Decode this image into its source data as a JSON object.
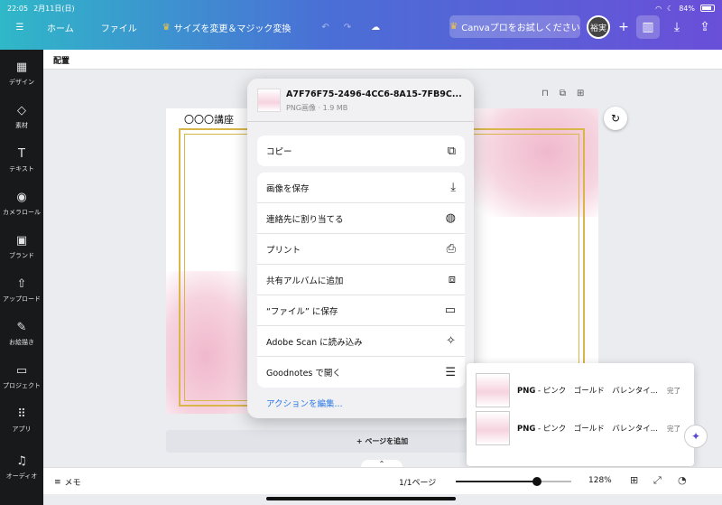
{
  "status_bar": {
    "time": "22:05",
    "date": "2月11日(日)",
    "battery": "84%"
  },
  "topbar": {
    "home": "ホーム",
    "file": "ファイル",
    "resize": "サイズを変更＆マジック変換",
    "pro": "Canvaプロをお試しください",
    "avatar": "裕実"
  },
  "sidebar": {
    "items": [
      {
        "label": "デザイン",
        "icon": "design-icon"
      },
      {
        "label": "素材",
        "icon": "elements-icon"
      },
      {
        "label": "テキスト",
        "icon": "text-icon"
      },
      {
        "label": "カメラロール",
        "icon": "camera-icon"
      },
      {
        "label": "ブランド",
        "icon": "brand-icon"
      },
      {
        "label": "アップロード",
        "icon": "upload-icon"
      },
      {
        "label": "お絵描き",
        "icon": "draw-icon"
      },
      {
        "label": "プロジェクト",
        "icon": "folder-icon"
      },
      {
        "label": "アプリ",
        "icon": "apps-icon"
      },
      {
        "label": "オーディオ",
        "icon": "audio-icon"
      }
    ]
  },
  "subheader": {
    "label": "配置"
  },
  "page": {
    "title": "〇〇〇講座"
  },
  "add_page": "+ ページを追加",
  "footer": {
    "memo": "メモ",
    "pages": "1/1ページ",
    "zoom": "128%",
    "zoom_level": 0.7
  },
  "share_sheet": {
    "file_name": "A7F76F75-2496-4CC6-8A15-7FB9C...",
    "file_meta": "PNG画像 · 1.9 MB",
    "copy": "コピー",
    "actions": [
      {
        "label": "画像を保存",
        "icon": "save-image-icon"
      },
      {
        "label": "連絡先に割り当てる",
        "icon": "contact-icon"
      },
      {
        "label": "プリント",
        "icon": "print-icon"
      },
      {
        "label": "共有アルバムに追加",
        "icon": "shared-album-icon"
      },
      {
        "label": "“ファイル” に保存",
        "icon": "folder-icon"
      },
      {
        "label": "Adobe Scan に読み込み",
        "icon": "adobe-scan-icon"
      },
      {
        "label": "Goodnotes で開く",
        "icon": "goodnotes-icon"
      }
    ],
    "edit_actions": "アクションを編集..."
  },
  "downloads": {
    "items": [
      {
        "format": "PNG",
        "name": " - ピンク　ゴールド　バレンタイ...",
        "status": "完了"
      },
      {
        "format": "PNG",
        "name": " - ピンク　ゴールド　バレンタイ...",
        "status": "完了"
      }
    ]
  }
}
